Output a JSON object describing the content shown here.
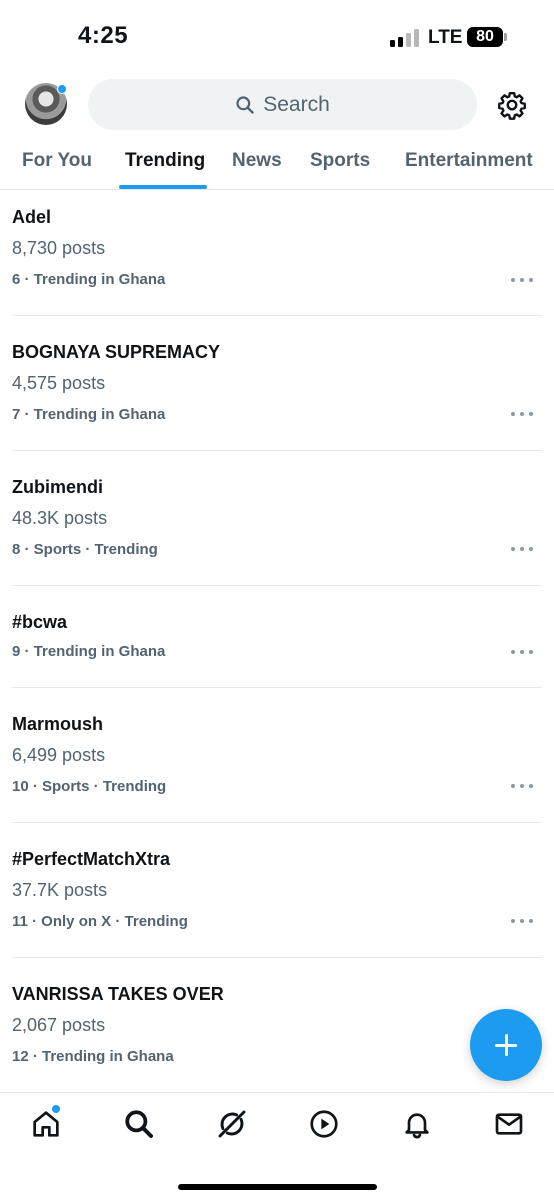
{
  "status_bar": {
    "time": "4:25",
    "network": "LTE",
    "battery": "80"
  },
  "header": {
    "search_placeholder": "Search",
    "avatar_badge_color": "#1d9bf0",
    "accent_color": "#1d9bf0"
  },
  "tabs": [
    {
      "label": "For You",
      "active": false
    },
    {
      "label": "Trending",
      "active": true
    },
    {
      "label": "News",
      "active": false
    },
    {
      "label": "Sports",
      "active": false
    },
    {
      "label": "Entertainment",
      "active": false
    }
  ],
  "trends": [
    {
      "name": "Adel",
      "posts": "8,730 posts",
      "meta": "6 · Trending in Ghana"
    },
    {
      "name": "BOGNAYA SUPREMACY",
      "posts": "4,575 posts",
      "meta": "7 · Trending in Ghana"
    },
    {
      "name": "Zubimendi",
      "posts": "48.3K posts",
      "meta": "8 · Sports · Trending"
    },
    {
      "name": "#bcwa",
      "posts": "",
      "meta": "9 · Trending in Ghana"
    },
    {
      "name": "Marmoush",
      "posts": "6,499 posts",
      "meta": "10 · Sports · Trending"
    },
    {
      "name": "#PerfectMatchXtra",
      "posts": "37.7K posts",
      "meta": "11 · Only on X · Trending"
    },
    {
      "name": "VANRISSA TAKES OVER",
      "posts": "2,067 posts",
      "meta": "12 · Trending in Ghana"
    }
  ],
  "fab": {
    "icon": "plus-icon"
  },
  "bottom_nav": [
    {
      "icon": "home-icon",
      "has_dot": true
    },
    {
      "icon": "search-icon",
      "has_dot": false
    },
    {
      "icon": "grok-icon",
      "has_dot": false
    },
    {
      "icon": "video-icon",
      "has_dot": false
    },
    {
      "icon": "bell-icon",
      "has_dot": false
    },
    {
      "icon": "mail-icon",
      "has_dot": false
    }
  ]
}
